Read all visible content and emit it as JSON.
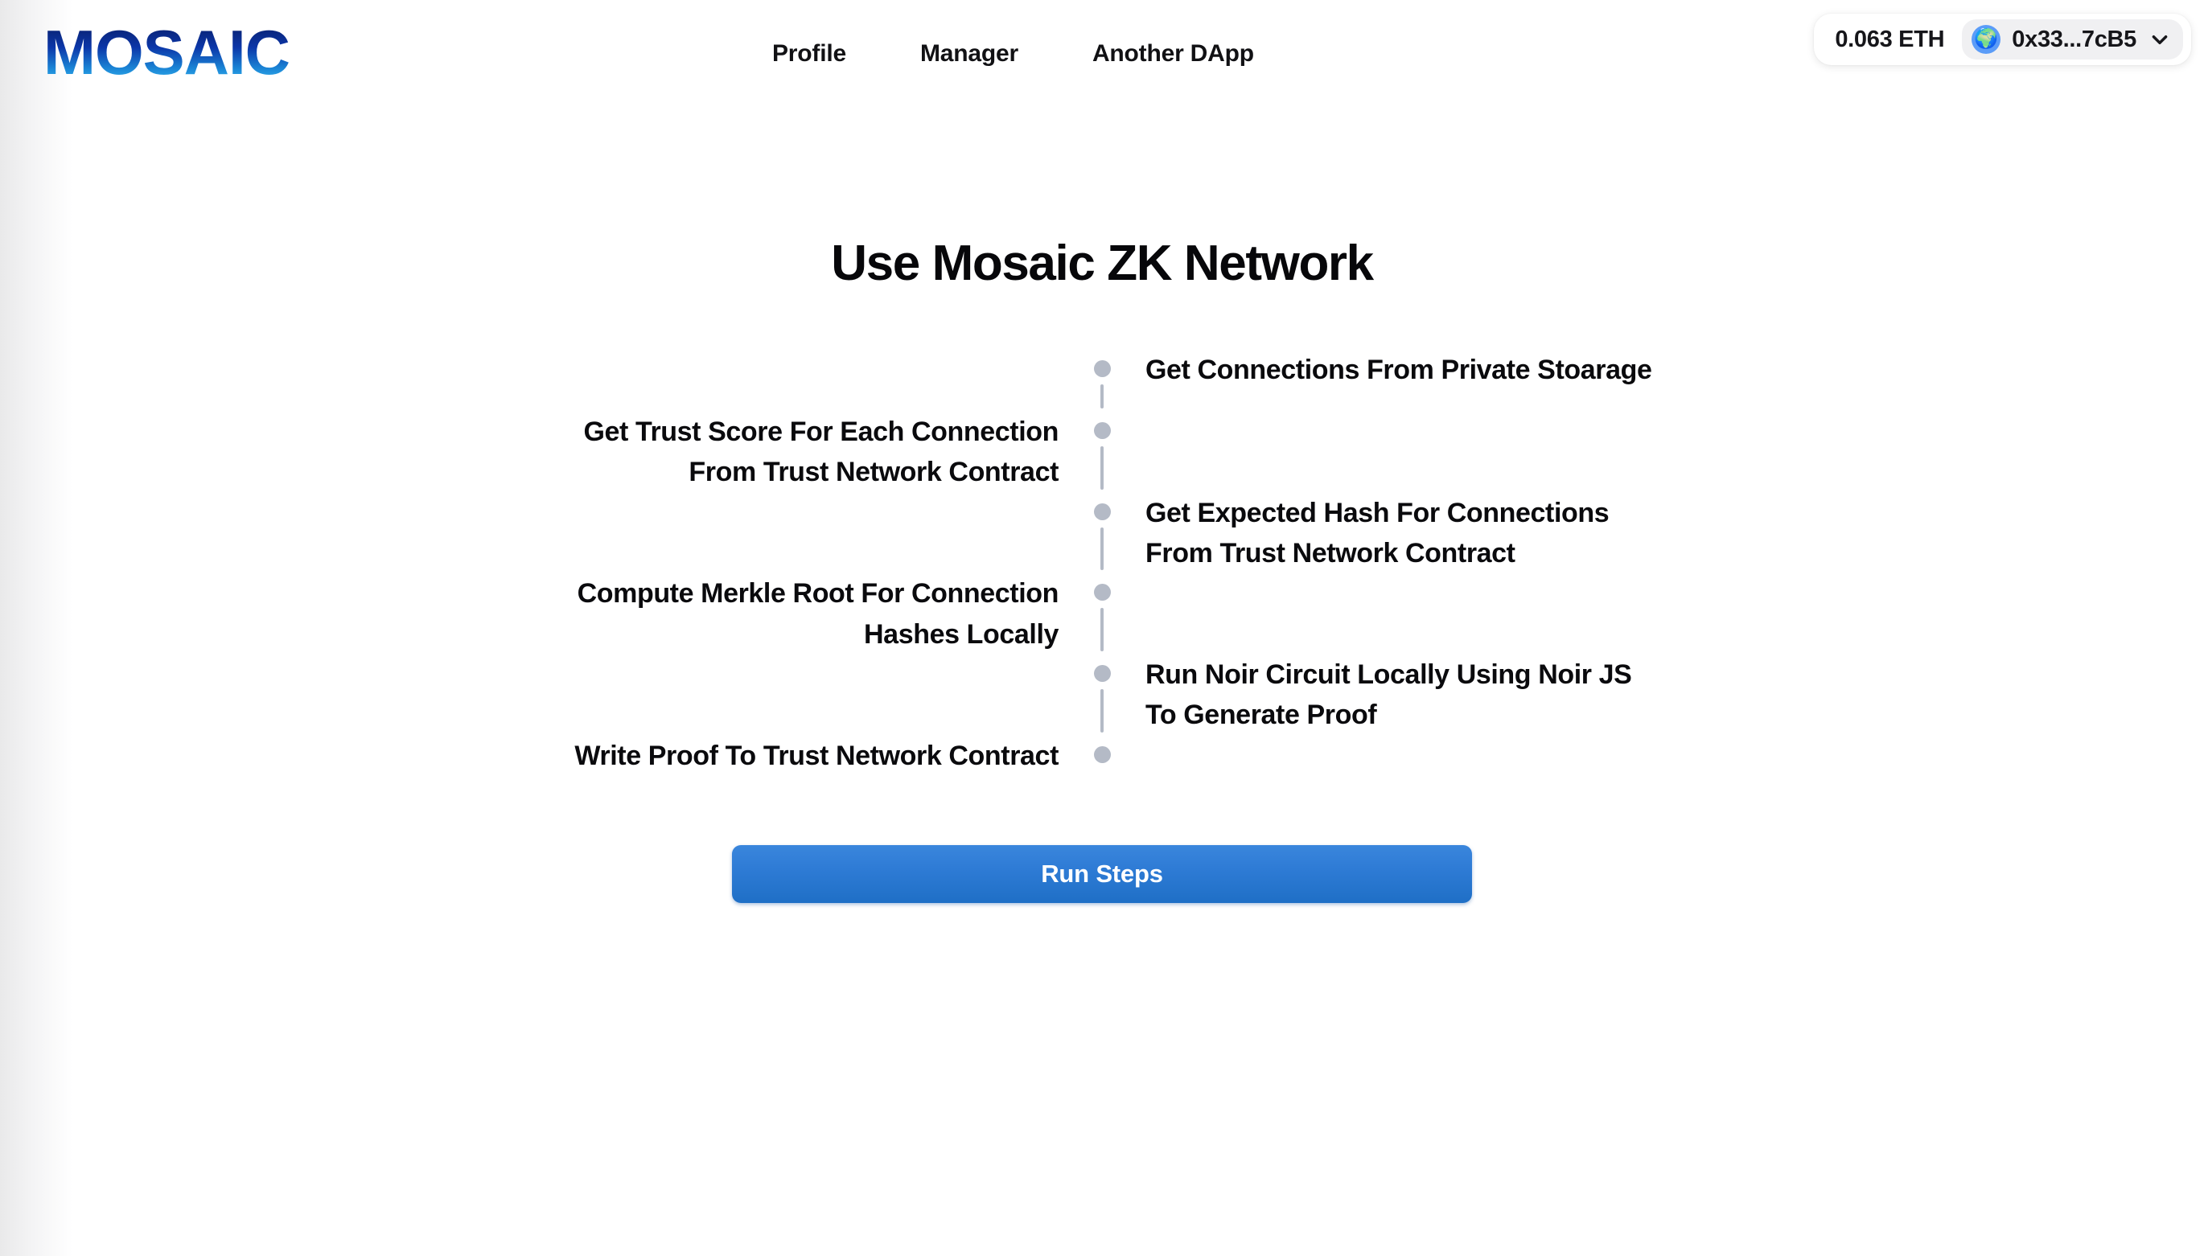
{
  "brand": {
    "name": "MOSAIC"
  },
  "nav": {
    "items": [
      {
        "label": "Profile"
      },
      {
        "label": "Manager"
      },
      {
        "label": "Another DApp"
      }
    ]
  },
  "wallet": {
    "balance": "0.063 ETH",
    "address": "0x33...7cB5",
    "avatar_icon": "globe-icon",
    "avatar_glyph": "🌍",
    "chevron_icon": "chevron-down-icon",
    "avatar_color": "#5b9cf8",
    "pill_color": "#f0f0f2"
  },
  "main": {
    "title": "Use Mosaic ZK Network",
    "run_button": {
      "label": "Run Steps",
      "color": "#2f7cd6"
    },
    "timeline": {
      "dot_color": "#b4bac6",
      "line_color": "#b4bac6",
      "steps": [
        {
          "label": "Get Connections From Private Stoarage",
          "side": "right"
        },
        {
          "label": "Get Trust Score For Each Connection From Trust Network Contract",
          "side": "left"
        },
        {
          "label": "Get Expected Hash For Connections From Trust Network Contract",
          "side": "right"
        },
        {
          "label": "Compute Merkle Root For Connection Hashes Locally",
          "side": "left"
        },
        {
          "label": "Run Noir Circuit Locally Using Noir JS To Generate Proof",
          "side": "right"
        },
        {
          "label": "Write Proof To Trust Network Contract",
          "side": "left"
        }
      ]
    }
  }
}
